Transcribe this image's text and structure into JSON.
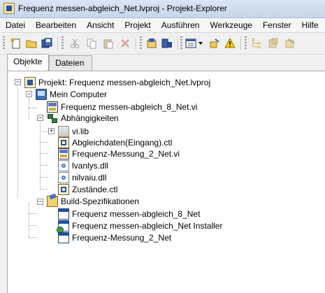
{
  "window": {
    "title": "Frequenz messen-abgleich_Net.lvproj - Projekt-Explorer"
  },
  "menu": [
    "Datei",
    "Bearbeiten",
    "Ansicht",
    "Projekt",
    "Ausführen",
    "Werkzeuge",
    "Fenster",
    "Hilfe"
  ],
  "toolbar": {
    "icons": [
      "new-icon",
      "open-icon",
      "save-all-icon",
      "cut-icon",
      "copy-icon",
      "paste-icon",
      "delete-icon",
      "build-icon",
      "deploy-icon",
      "view-icon",
      "filter-icon",
      "warning-icon",
      "tree-icon",
      "source-control-icon",
      "properties-icon"
    ],
    "accent": "#2c4f9a"
  },
  "tabs": {
    "objects": "Objekte",
    "files": "Dateien"
  },
  "tree": {
    "project": "Projekt: Frequenz messen-abgleich_Net.lvproj",
    "computer": "Mein Computer",
    "vi_main": "Frequenz messen-abgleich_8_Net.vi",
    "dependencies": "Abhängigkeiten",
    "vilib": "vi.lib",
    "ctl_abgleich": "Abgleichdaten(Eingang).ctl",
    "vi_messung": "Frequenz-Messung_2_Net.vi",
    "dll_lvanlys": "lvanlys.dll",
    "dll_nilvaiu": "nilvaiu.dll",
    "ctl_zustaende": "Zustände.ctl",
    "build_specs": "Build-Spezifikationen",
    "build_app": "Frequenz messen-abgleich_8_Net",
    "build_installer": "Frequenz messen-abgleich_Net Installer",
    "build_messung": "Frequenz-Messung_2_Net"
  }
}
